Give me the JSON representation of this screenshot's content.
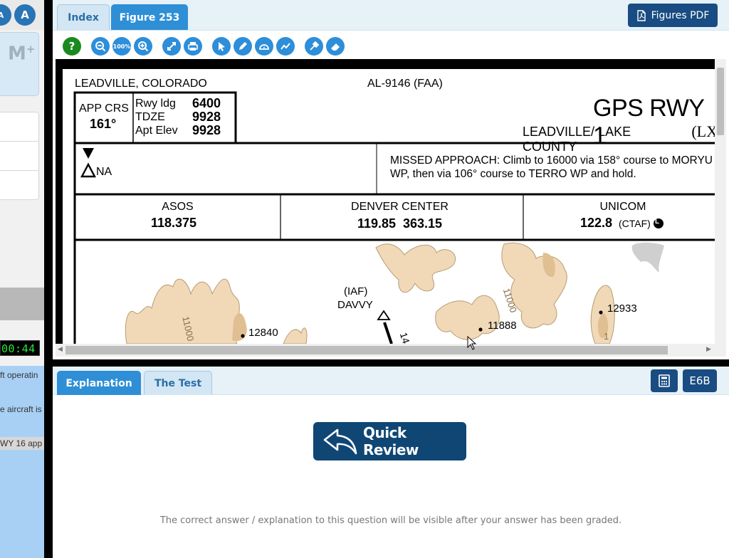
{
  "left_strip": {
    "font_down_label": "A",
    "font_up_label": "A",
    "memory_label": "M",
    "memory_sup": "+",
    "timer": "00:44",
    "question_snippets": [
      "ft operatin",
      "e aircraft is",
      "WY 16 app"
    ]
  },
  "figure_tabs": [
    {
      "label": "Index"
    },
    {
      "label": "Figure 253"
    }
  ],
  "figures_pdf_label": "Figures PDF",
  "toolbar_icons": [
    "help-icon",
    "zoom-out-icon",
    "zoom-100-icon",
    "zoom-in-icon",
    "fit-icon",
    "print-icon",
    "pointer-icon",
    "pencil-icon",
    "protractor-icon",
    "line-icon",
    "eyedropper-icon",
    "eraser-icon"
  ],
  "toolbar_zoom_label": "100%",
  "chart": {
    "location": "LEADVILLE, COLORADO",
    "procedure_id": "AL-9146 (FAA)",
    "title": "GPS RWY 1",
    "airport": "LEADVILLE/ LAKE COUNTY",
    "airport_code": "(LX",
    "app_crs_label": "APP CRS",
    "app_crs_value": "161°",
    "rwy_ldg_label": "Rwy ldg",
    "rwy_ldg_value": "6400",
    "tdze_label": "TDZE",
    "tdze_value": "9928",
    "apt_elev_label": "Apt Elev",
    "apt_elev_value": "9928",
    "na_label": "NA",
    "missed_approach_line1": "MISSED APPROACH:  Climb to 16000 via 158° course to MORYU",
    "missed_approach_line2": "WP, then via 106° course to TERRO WP and hold.",
    "comms": [
      {
        "name": "ASOS",
        "freq": "118.375",
        "suffix": ""
      },
      {
        "name": "DENVER CENTER",
        "freq": "119.85  363.15",
        "suffix": ""
      },
      {
        "name": "UNICOM",
        "freq": "122.8",
        "suffix": "(CTAF)"
      }
    ],
    "ctaf_badge": "L",
    "iaf_label": "(IAF)",
    "fix_name": "DAVVY",
    "elev_12840": "12840",
    "elev_11888": "11888",
    "elev_12933": "12933",
    "contour_11000_a": "11000",
    "contour_11000_b": "11000",
    "partial_label": "1",
    "partial_label_2": "14"
  },
  "bottom_tabs": [
    {
      "label": "Explanation"
    },
    {
      "label": "The Test"
    }
  ],
  "e6b_label": "E6B",
  "quick_review_label": "Quick Review",
  "explanation_note": "The correct answer / explanation to this question will be visible after your answer has been graded."
}
